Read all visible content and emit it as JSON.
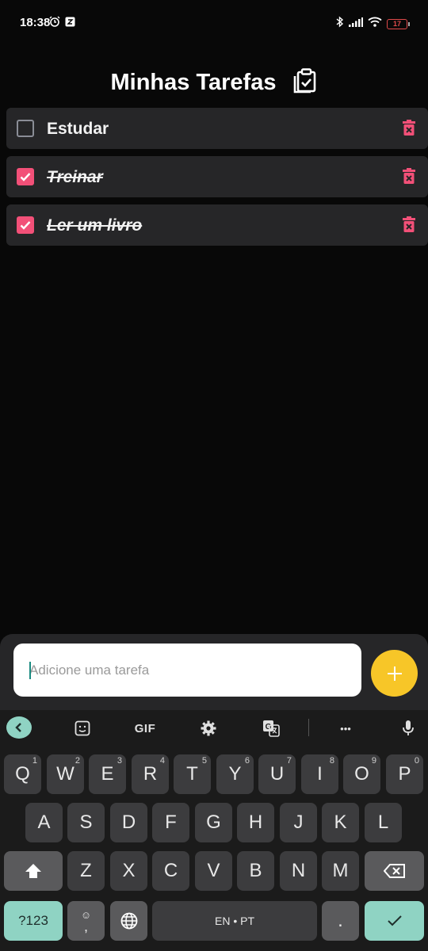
{
  "status_bar": {
    "time": "18:38",
    "battery": "17",
    "icons": [
      "alarm-icon",
      "notification-app-icon",
      "bluetooth-icon",
      "signal-icon",
      "wifi-icon",
      "battery-icon"
    ]
  },
  "header": {
    "title": "Minhas Tarefas",
    "icon": "clipboard-check-icon"
  },
  "tasks": [
    {
      "label": "Estudar",
      "done": false
    },
    {
      "label": "Treinar",
      "done": true
    },
    {
      "label": "Ler um livro",
      "done": true
    }
  ],
  "input": {
    "placeholder": "Adicione uma tarefa",
    "value": ""
  },
  "add_button": {
    "label": "+"
  },
  "keyboard": {
    "toolbar": {
      "gif_label": "GIF",
      "more_label": "•••"
    },
    "row1": [
      {
        "k": "Q",
        "h": "1"
      },
      {
        "k": "W",
        "h": "2"
      },
      {
        "k": "E",
        "h": "3"
      },
      {
        "k": "R",
        "h": "4"
      },
      {
        "k": "T",
        "h": "5"
      },
      {
        "k": "Y",
        "h": "6"
      },
      {
        "k": "U",
        "h": "7"
      },
      {
        "k": "I",
        "h": "8"
      },
      {
        "k": "O",
        "h": "9"
      },
      {
        "k": "P",
        "h": "0"
      }
    ],
    "row2": [
      "A",
      "S",
      "D",
      "F",
      "G",
      "H",
      "J",
      "K",
      "L"
    ],
    "row3": [
      "Z",
      "X",
      "C",
      "V",
      "B",
      "N",
      "M"
    ],
    "symbols_label": "?123",
    "emoji_comma": ",",
    "space_label": "EN • PT",
    "period": ".",
    "colors": {
      "accent_pink": "#f25078",
      "accent_yellow": "#f7c628",
      "accent_mint": "#8fd3c3"
    }
  }
}
